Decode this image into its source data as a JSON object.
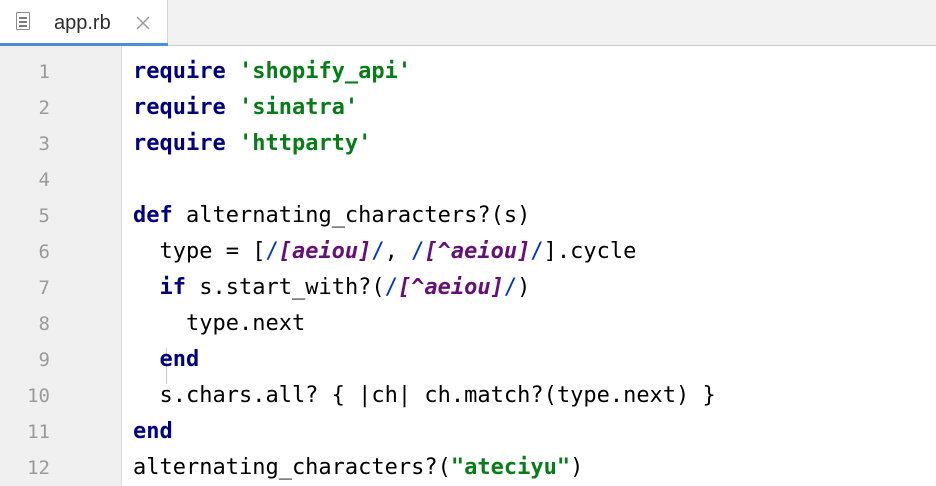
{
  "tab": {
    "label": "app.rb",
    "icon": "file-icon",
    "close_icon": "close-icon"
  },
  "colors": {
    "keyword": "#000080",
    "string": "#067d17",
    "regex": "#660e7a",
    "tab_accent": "#4d8fd6"
  },
  "line_numbers": [
    "1",
    "2",
    "3",
    "4",
    "5",
    "6",
    "7",
    "8",
    "9",
    "10",
    "11",
    "12"
  ],
  "code": {
    "l1": {
      "kw": "require",
      "sp": " ",
      "str": "'shopify_api'"
    },
    "l2": {
      "kw": "require",
      "sp": " ",
      "str": "'sinatra'"
    },
    "l3": {
      "kw": "require",
      "sp": " ",
      "str": "'httparty'"
    },
    "l5": {
      "kw": "def",
      "rest": " alternating_characters?(s)"
    },
    "l6": {
      "a": "  type = [",
      "d1": "/",
      "r1": "[aeiou]",
      "d2": "/",
      "b": ", ",
      "d3": "/",
      "r2": "[^aeiou]",
      "d4": "/",
      "c": "].cycle"
    },
    "l7": {
      "ind": "  ",
      "kw": "if",
      "a": " s.start_with?(",
      "d1": "/",
      "r1": "[^aeiou]",
      "d2": "/",
      "b": ")"
    },
    "l8": {
      "text": "    type.next"
    },
    "l9": {
      "ind": "  ",
      "kw": "end"
    },
    "l10": {
      "text": "  s.chars.all? { |ch| ch.match?(type.next) }"
    },
    "l11": {
      "kw": "end"
    },
    "l12": {
      "a": "alternating_characters?(",
      "str": "\"ateciyu\"",
      "b": ")"
    }
  }
}
